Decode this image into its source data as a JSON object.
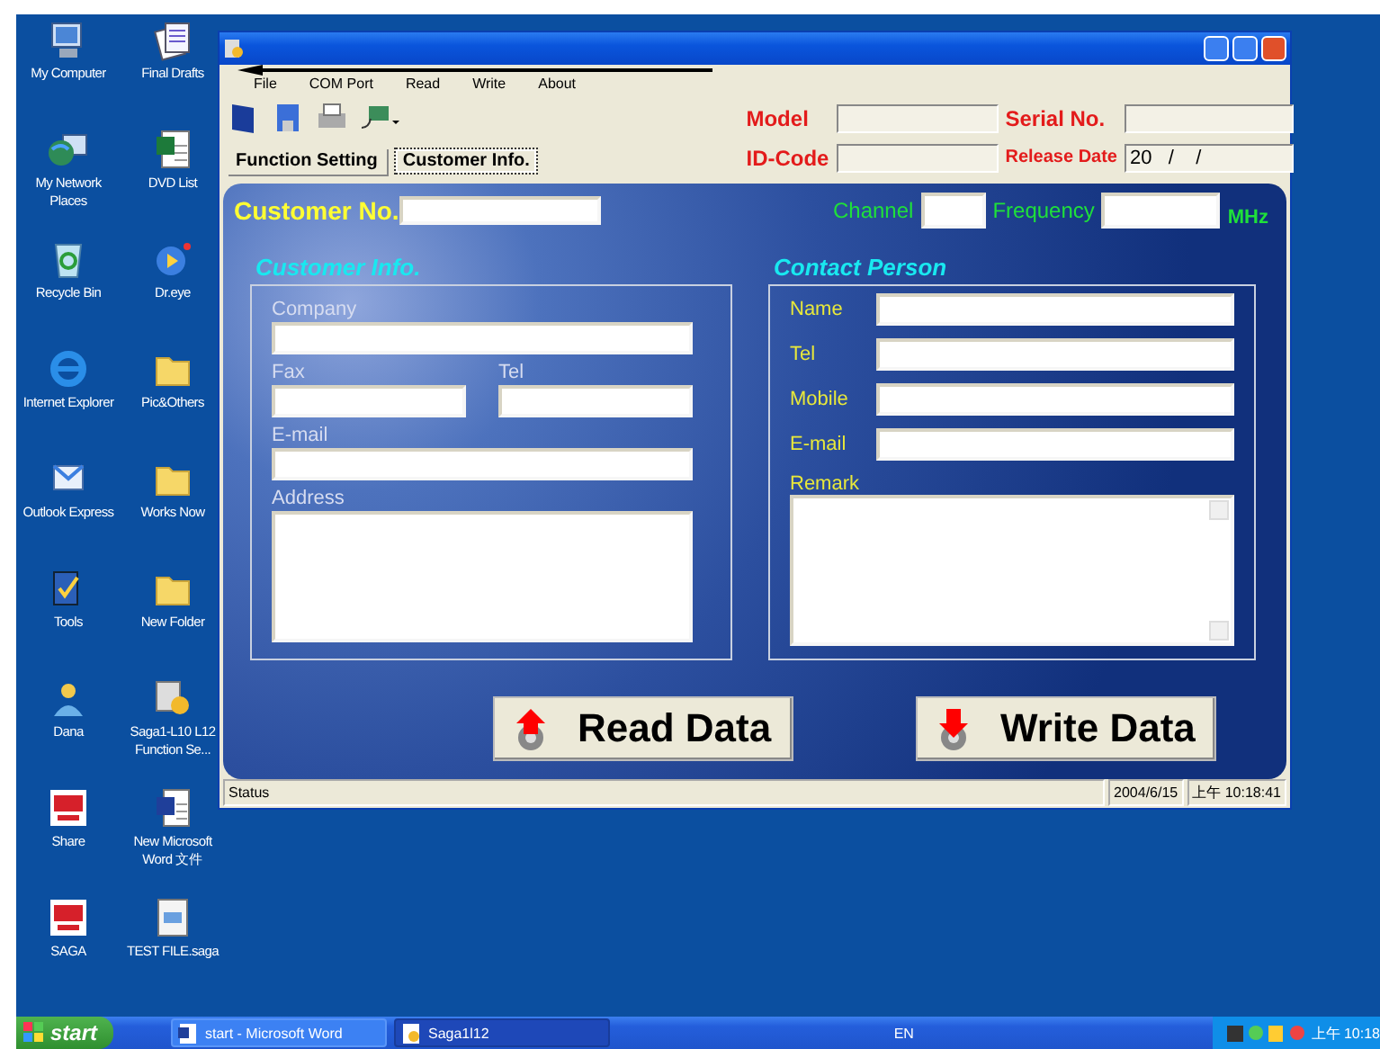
{
  "desktop_icons": [
    {
      "label": "My Computer",
      "kind": "computer"
    },
    {
      "label": "Final Drafts",
      "kind": "documents"
    },
    {
      "label": "My Network Places",
      "kind": "network"
    },
    {
      "label": "DVD List",
      "kind": "spreadsheet"
    },
    {
      "label": "Recycle Bin",
      "kind": "recycle"
    },
    {
      "label": "Dr.eye",
      "kind": "app"
    },
    {
      "label": "Internet Explorer",
      "kind": "browser"
    },
    {
      "label": "Pic&Others",
      "kind": "folder"
    },
    {
      "label": "Outlook Express",
      "kind": "mail"
    },
    {
      "label": "Works Now",
      "kind": "folder"
    },
    {
      "label": "Tools",
      "kind": "tools"
    },
    {
      "label": "New Folder",
      "kind": "folder"
    },
    {
      "label": "Dana",
      "kind": "user"
    },
    {
      "label": "Saga1-L10 L12 Function Se...",
      "kind": "setup"
    },
    {
      "label": "Share",
      "kind": "logo"
    },
    {
      "label": "New Microsoft Word 文件",
      "kind": "word"
    },
    {
      "label": "SAGA",
      "kind": "logo"
    },
    {
      "label": "TEST FILE.saga",
      "kind": "file"
    }
  ],
  "window": {
    "menu": [
      "File",
      "COM Port",
      "Read",
      "Write",
      "About"
    ],
    "tabs": [
      {
        "label": "Function Setting",
        "selected": false
      },
      {
        "label": "Customer Info.",
        "selected": true
      }
    ],
    "header_fields": [
      {
        "label": "Model"
      },
      {
        "label": "Serial No."
      },
      {
        "label": "ID-Code"
      },
      {
        "label": "Release Date",
        "value": "20   /    /"
      }
    ]
  },
  "panel": {
    "customer_no_label": "Customer No.",
    "channel_label": "Channel",
    "frequency_label": "Frequency",
    "unit": "MHz",
    "customer_group": {
      "title": "Customer Info.",
      "fields": [
        {
          "label": "Company",
          "kind": "full"
        },
        {
          "label": "Fax",
          "kind": "half"
        },
        {
          "label": "Tel",
          "kind": "half"
        },
        {
          "label": "E-mail",
          "kind": "full"
        },
        {
          "label": "Address",
          "kind": "area"
        }
      ]
    },
    "contact_group": {
      "title": "Contact Person",
      "fields": [
        {
          "label": "Name",
          "kind": "line"
        },
        {
          "label": "Tel",
          "kind": "line"
        },
        {
          "label": "Mobile",
          "kind": "line"
        },
        {
          "label": "E-mail",
          "kind": "line"
        },
        {
          "label": "Remark",
          "kind": "area"
        }
      ]
    },
    "buttons": [
      {
        "label": "Read Data",
        "kind": "read"
      },
      {
        "label": "Write Data",
        "kind": "write"
      }
    ]
  },
  "status_bar": [
    "Status",
    "2004/6/15",
    "上午 10:18:41"
  ],
  "taskbar": {
    "start": "start",
    "tasks": [
      {
        "label": "start - Microsoft Word",
        "kind": "word",
        "selected": false
      },
      {
        "label": "Saga1l12",
        "kind": "setup",
        "selected": true
      }
    ],
    "language": "EN",
    "clock": "上午 10:18"
  }
}
